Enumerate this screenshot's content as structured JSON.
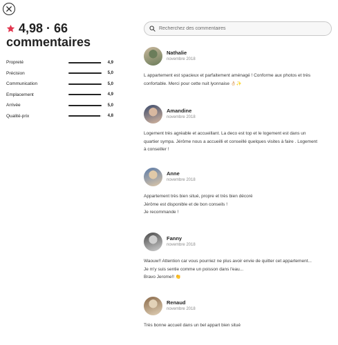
{
  "header": {
    "rating": "4,98 · 66",
    "rating_sub": "commentaires"
  },
  "categories": [
    {
      "label": "Propreté",
      "value": "4,9",
      "fraction": 0.98
    },
    {
      "label": "Précision",
      "value": "5,0",
      "fraction": 1.0
    },
    {
      "label": "Communication",
      "value": "5,0",
      "fraction": 1.0
    },
    {
      "label": "Emplacement",
      "value": "4,9",
      "fraction": 0.98
    },
    {
      "label": "Arrivée",
      "value": "5,0",
      "fraction": 1.0
    },
    {
      "label": "Qualité-prix",
      "value": "4,8",
      "fraction": 0.96
    }
  ],
  "search": {
    "placeholder": "Recherchez des commentaires"
  },
  "reviews": [
    {
      "name": "Nathalie",
      "date": "novembre 2018",
      "lines": [
        "L appartement est spacieux et parfaitement aménagé ! Conforme aux photos et très",
        "confortable. Merci pour cette nuit lyonnaise 👌🏻✨"
      ]
    },
    {
      "name": "Amandine",
      "date": "novembre 2018",
      "lines": [
        "Logement très agréable et accueillant. La deco est top et le logement est dans un",
        "quartier sympa. Jérôme nous a accueilli et conseillé quelques visites à faire . Logement",
        "à conseiller !"
      ]
    },
    {
      "name": "Anne",
      "date": "novembre 2018",
      "lines": [
        "Appartement très bien situé, propre et très bien décoré",
        "Jérôme est disponible et de bon conseils !",
        "Je recommande !"
      ]
    },
    {
      "name": "Fanny",
      "date": "novembre 2018",
      "lines": [
        "Waouw!! Attention car vous pourriez ne plus avoir envie de quitter cet appartement...",
        "Je m'y suis sentie comme un poisson dans l'eau...",
        "Bravo Jerome!! 👏"
      ]
    },
    {
      "name": "Renaud",
      "date": "novembre 2018",
      "lines": [
        "Très bonne accueil dans un bel appart bien situé"
      ]
    }
  ],
  "colors": {
    "star": "#e2374f",
    "bar_fill": "#222222",
    "bar_track": "#dddddd"
  },
  "icons": [
    "close-icon",
    "star-icon",
    "search-icon"
  ]
}
